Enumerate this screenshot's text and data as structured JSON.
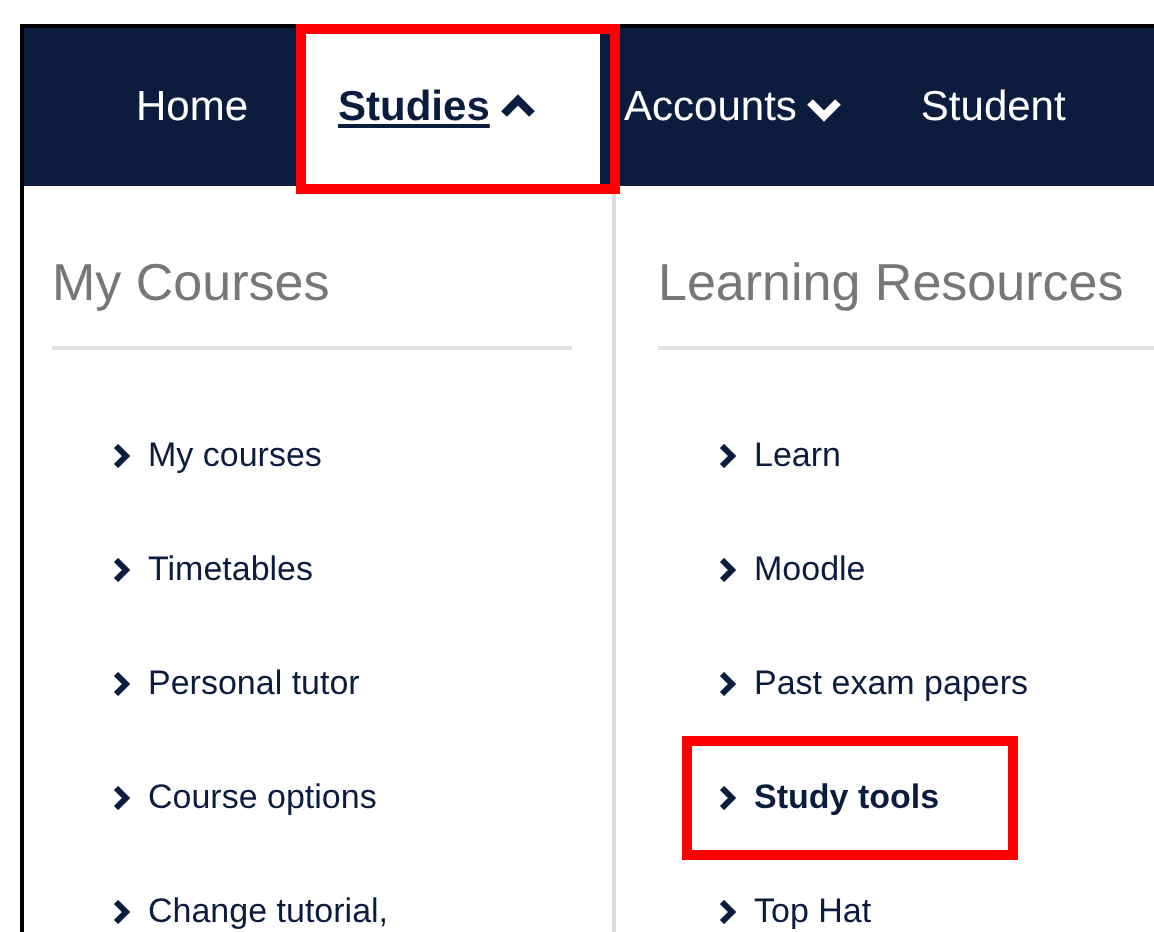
{
  "nav": {
    "tabs": [
      {
        "label": "Home",
        "kind": "link",
        "selected": false,
        "highlighted": false
      },
      {
        "label": "Studies",
        "kind": "dropdown",
        "expanded": true,
        "selected": true,
        "highlighted": true
      },
      {
        "label": "Accounts",
        "kind": "dropdown",
        "expanded": false,
        "selected": false,
        "highlighted": false
      },
      {
        "label": "Student",
        "kind": "link",
        "selected": false,
        "highlighted": false
      }
    ]
  },
  "columns": [
    {
      "heading": "My Courses",
      "items": [
        {
          "label": "My courses",
          "highlighted": false
        },
        {
          "label": "Timetables",
          "highlighted": false
        },
        {
          "label": "Personal tutor",
          "highlighted": false
        },
        {
          "label": "Course options",
          "highlighted": false
        },
        {
          "label": "Change tutorial,",
          "highlighted": false
        }
      ]
    },
    {
      "heading": "Learning Resources",
      "items": [
        {
          "label": "Learn",
          "highlighted": false
        },
        {
          "label": "Moodle",
          "highlighted": false
        },
        {
          "label": "Past exam papers",
          "highlighted": false
        },
        {
          "label": "Study tools",
          "highlighted": true
        },
        {
          "label": "Top Hat",
          "highlighted": false
        }
      ]
    }
  ]
}
